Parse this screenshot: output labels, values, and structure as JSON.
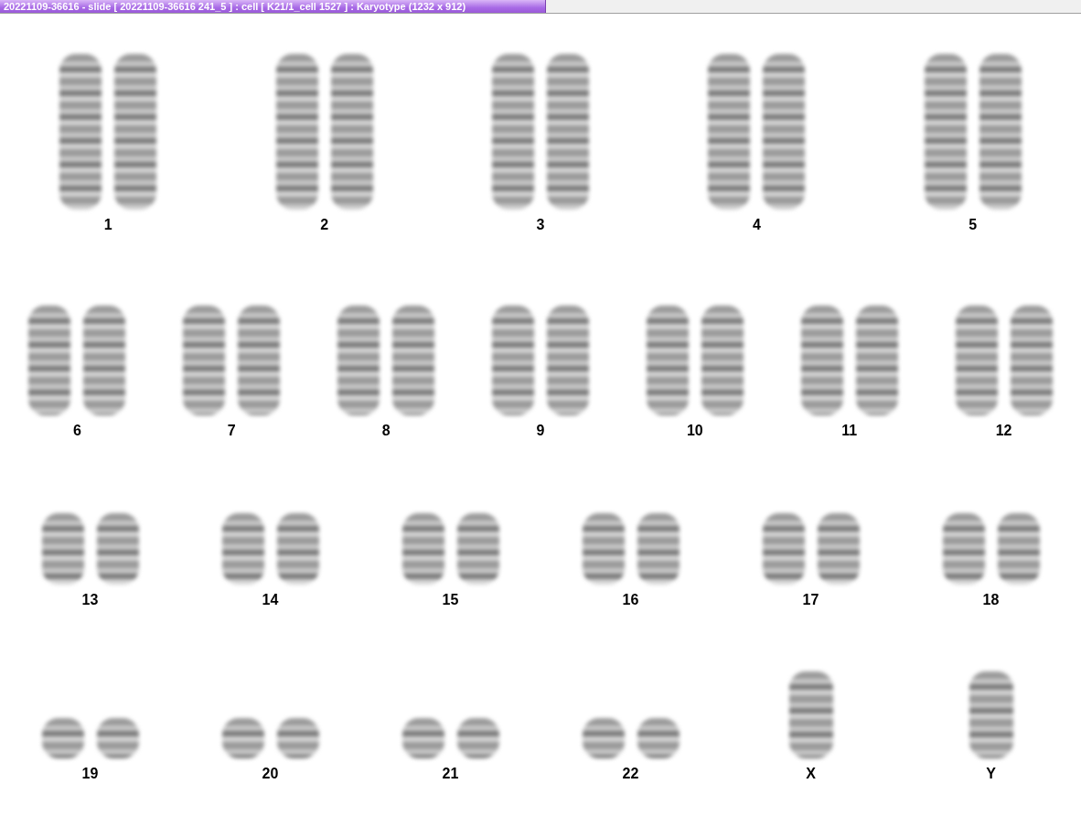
{
  "window": {
    "title": "20221109-36616 - slide [ 20221109-36616 241_5 ] : cell [ K21/1_cell 1527 ] : Karyotype  (1232 x 912)"
  },
  "karyotype": {
    "rows": [
      {
        "chromosomes": [
          {
            "label": "1",
            "kind": "pair"
          },
          {
            "label": "2",
            "kind": "pair"
          },
          {
            "label": "3",
            "kind": "pair"
          },
          {
            "label": "4",
            "kind": "pair"
          },
          {
            "label": "5",
            "kind": "pair"
          }
        ]
      },
      {
        "chromosomes": [
          {
            "label": "6",
            "kind": "pair"
          },
          {
            "label": "7",
            "kind": "pair"
          },
          {
            "label": "8",
            "kind": "pair"
          },
          {
            "label": "9",
            "kind": "pair"
          },
          {
            "label": "10",
            "kind": "pair"
          },
          {
            "label": "11",
            "kind": "pair"
          },
          {
            "label": "12",
            "kind": "pair"
          }
        ]
      },
      {
        "chromosomes": [
          {
            "label": "13",
            "kind": "pair"
          },
          {
            "label": "14",
            "kind": "pair"
          },
          {
            "label": "15",
            "kind": "pair"
          },
          {
            "label": "16",
            "kind": "pair"
          },
          {
            "label": "17",
            "kind": "pair"
          },
          {
            "label": "18",
            "kind": "pair"
          }
        ]
      },
      {
        "chromosomes": [
          {
            "label": "19",
            "kind": "pair"
          },
          {
            "label": "20",
            "kind": "pair"
          },
          {
            "label": "21",
            "kind": "pair"
          },
          {
            "label": "22",
            "kind": "pair"
          },
          {
            "label": "X",
            "kind": "single"
          },
          {
            "label": "Y",
            "kind": "single"
          }
        ]
      }
    ]
  }
}
